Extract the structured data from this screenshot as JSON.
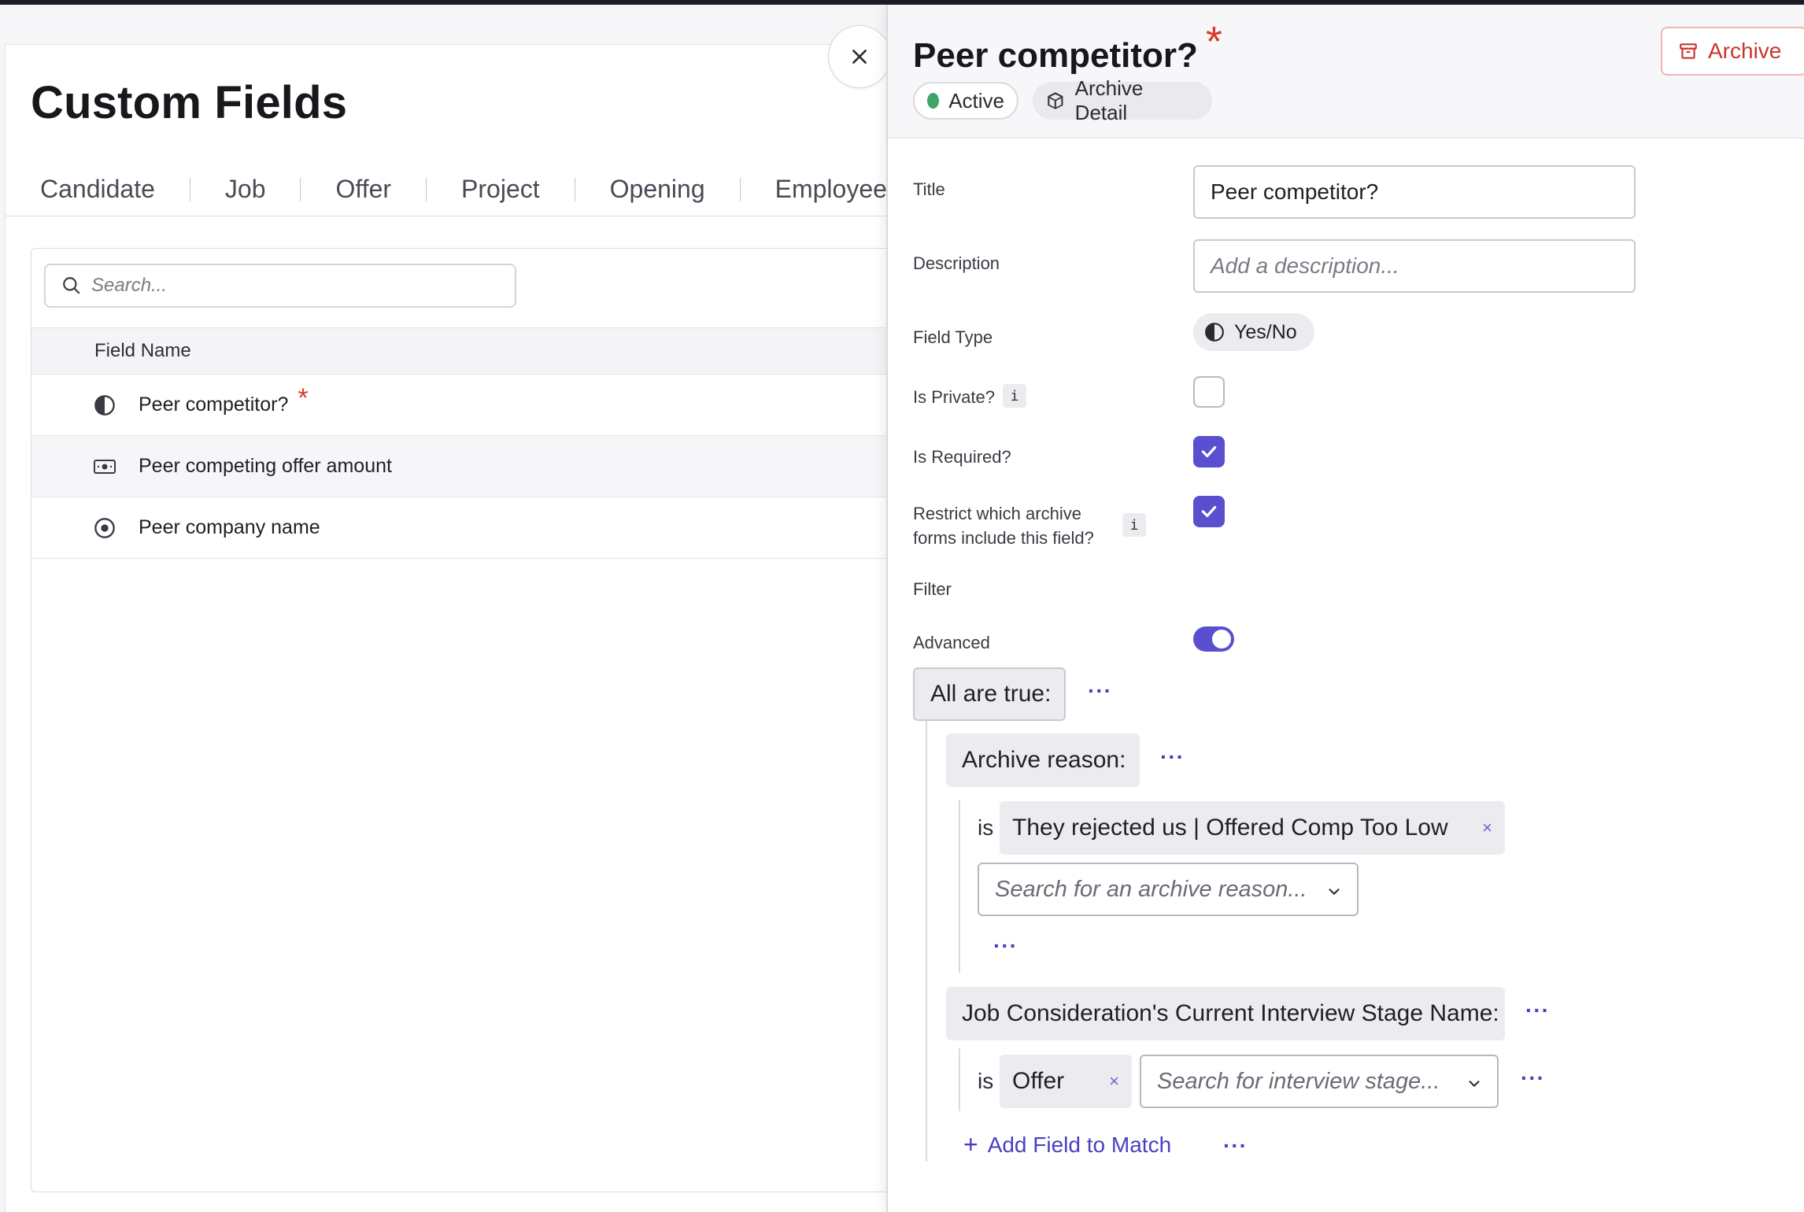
{
  "page": {
    "title": "Custom Fields",
    "tabs": [
      "Candidate",
      "Job",
      "Offer",
      "Project",
      "Opening",
      "Employee"
    ],
    "search_placeholder": "Search...",
    "column_header": "Field Name",
    "rows": [
      {
        "name": "Peer competitor?",
        "icon": "half-circle-icon",
        "required": "*"
      },
      {
        "name": "Peer competing offer amount",
        "icon": "money-icon"
      },
      {
        "name": "Peer company name",
        "icon": "radio-dot-icon"
      }
    ]
  },
  "drawer": {
    "title": "Peer competitor?",
    "required_mark": "*",
    "archive_label": "Archive",
    "status_label": "Active",
    "archive_detail_label": "Archive Detail",
    "fields": {
      "title_label": "Title",
      "title_value": "Peer competitor?",
      "description_label": "Description",
      "description_placeholder": "Add a description...",
      "field_type_label": "Field Type",
      "field_type_value": "Yes/No",
      "is_private_label": "Is Private?",
      "is_private_checked": false,
      "is_required_label": "Is Required?",
      "is_required_checked": true,
      "restrict_label_line1": "Restrict which archive",
      "restrict_label_line2": "forms include this field?",
      "restrict_checked": true,
      "info_glyph": "i",
      "filter_label": "Filter",
      "advanced_label": "Advanced",
      "advanced_on": true
    },
    "filter": {
      "root_label": "All are true:",
      "more": "···",
      "conditions": [
        {
          "label": "Archive reason:",
          "operator": "is",
          "value": "They rejected us | Offered Comp Too Low",
          "select_placeholder": "Search for an archive reason..."
        },
        {
          "label": "Job Consideration's Current Interview Stage Name:",
          "operator": "is",
          "value": "Offer",
          "select_placeholder": "Search for interview stage..."
        }
      ],
      "add_field_label": "Add Field to Match",
      "add_plus": "+",
      "remove_glyph": "×"
    }
  },
  "colors": {
    "accent": "#5a4fcf",
    "link": "#4a3fc0",
    "danger": "#d8392b",
    "success": "#3fa46a"
  }
}
